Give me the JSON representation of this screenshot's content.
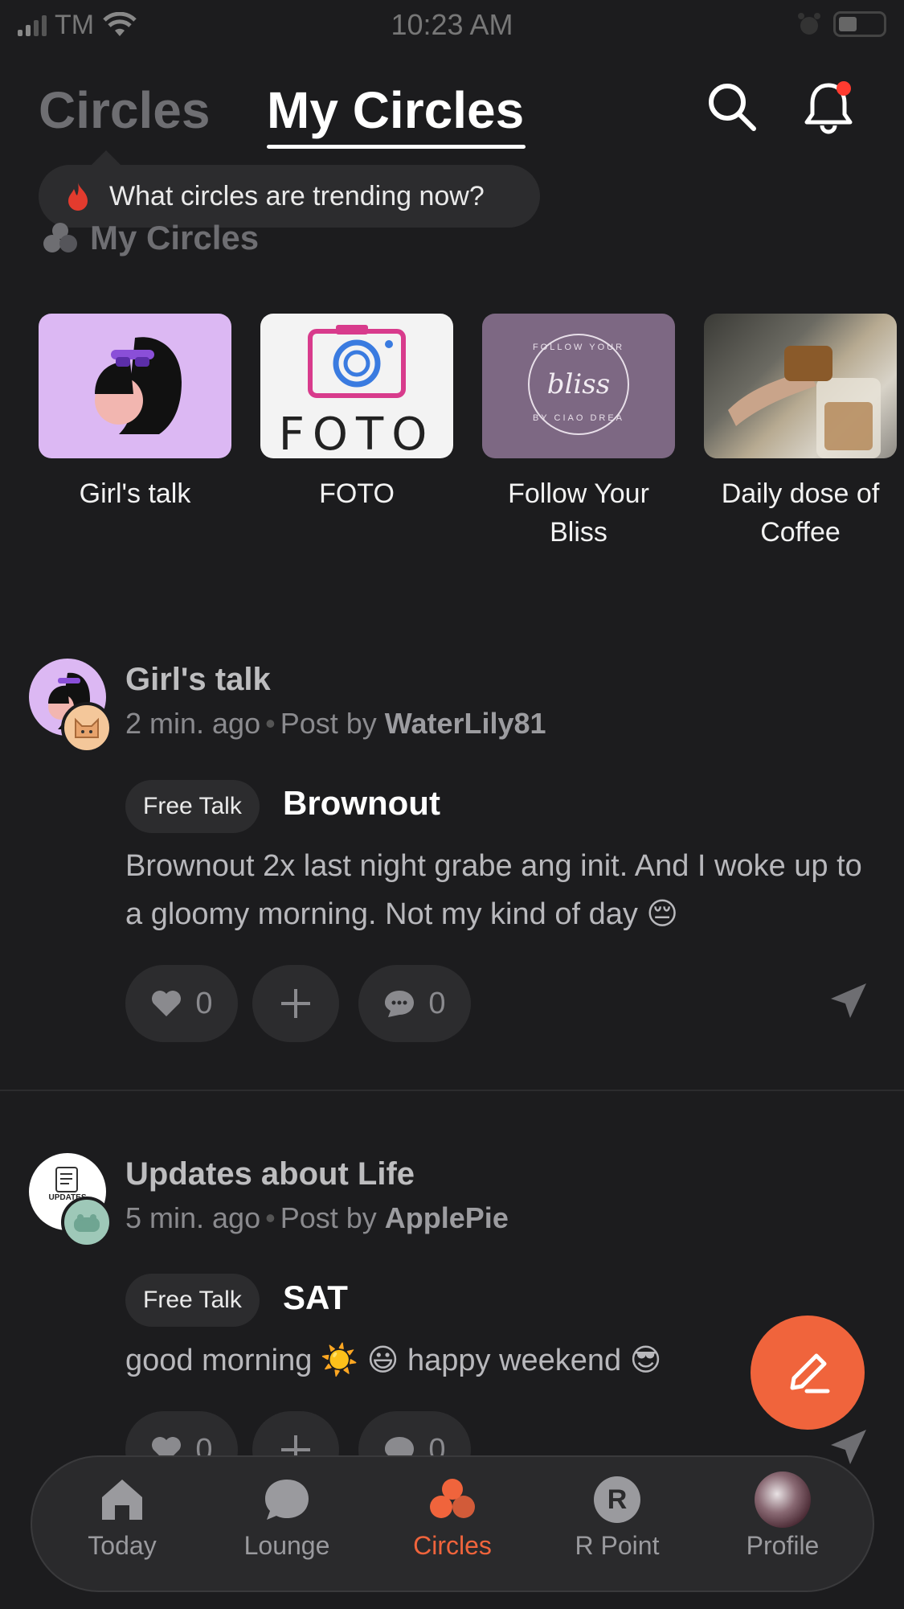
{
  "status_bar": {
    "carrier": "TM",
    "time": "10:23 AM"
  },
  "header": {
    "tab_circles": "Circles",
    "tab_my_circles": "My Circles"
  },
  "trending": {
    "text": "What circles are trending now?"
  },
  "section": {
    "title": "My Circles"
  },
  "circles": [
    {
      "label": "Girl's talk"
    },
    {
      "label": "FOTO",
      "thumb_text": "FOTO"
    },
    {
      "label": "Follow Your Bliss",
      "thumb_text": "bliss",
      "thumb_top": "FOLLOW YOUR",
      "thumb_bottom": "BY CIAO DREA"
    },
    {
      "label": "Daily dose of Coffee"
    }
  ],
  "posts": [
    {
      "circle": "Girl's talk",
      "time": "2 min. ago",
      "post_by": "Post by",
      "author": "WaterLily81",
      "tag": "Free Talk",
      "title": "Brownout",
      "body": "Brownout 2x last night grabe ang init. And I woke up to a gloomy morning. Not my kind of day 😔",
      "likes": "0",
      "comments": "0"
    },
    {
      "circle": "Updates about Life",
      "time": "5 min. ago",
      "post_by": "Post by",
      "author": "ApplePie",
      "tag": "Free Talk",
      "title": "SAT",
      "body": "good morning ☀️ 😃 happy weekend 😎",
      "avatar_text": "UPDATES",
      "likes": "0",
      "comments": "0"
    }
  ],
  "nav": [
    {
      "label": "Today",
      "icon": "home-icon"
    },
    {
      "label": "Lounge",
      "icon": "chat-bubble-icon"
    },
    {
      "label": "Circles",
      "icon": "circles-icon",
      "active": true
    },
    {
      "label": "R Point",
      "icon": "r-point-icon",
      "icon_text": "R"
    },
    {
      "label": "Profile",
      "icon": "profile-avatar"
    }
  ],
  "colors": {
    "accent": "#f0643c",
    "background": "#1c1c1e",
    "card": "#2c2c2e"
  }
}
